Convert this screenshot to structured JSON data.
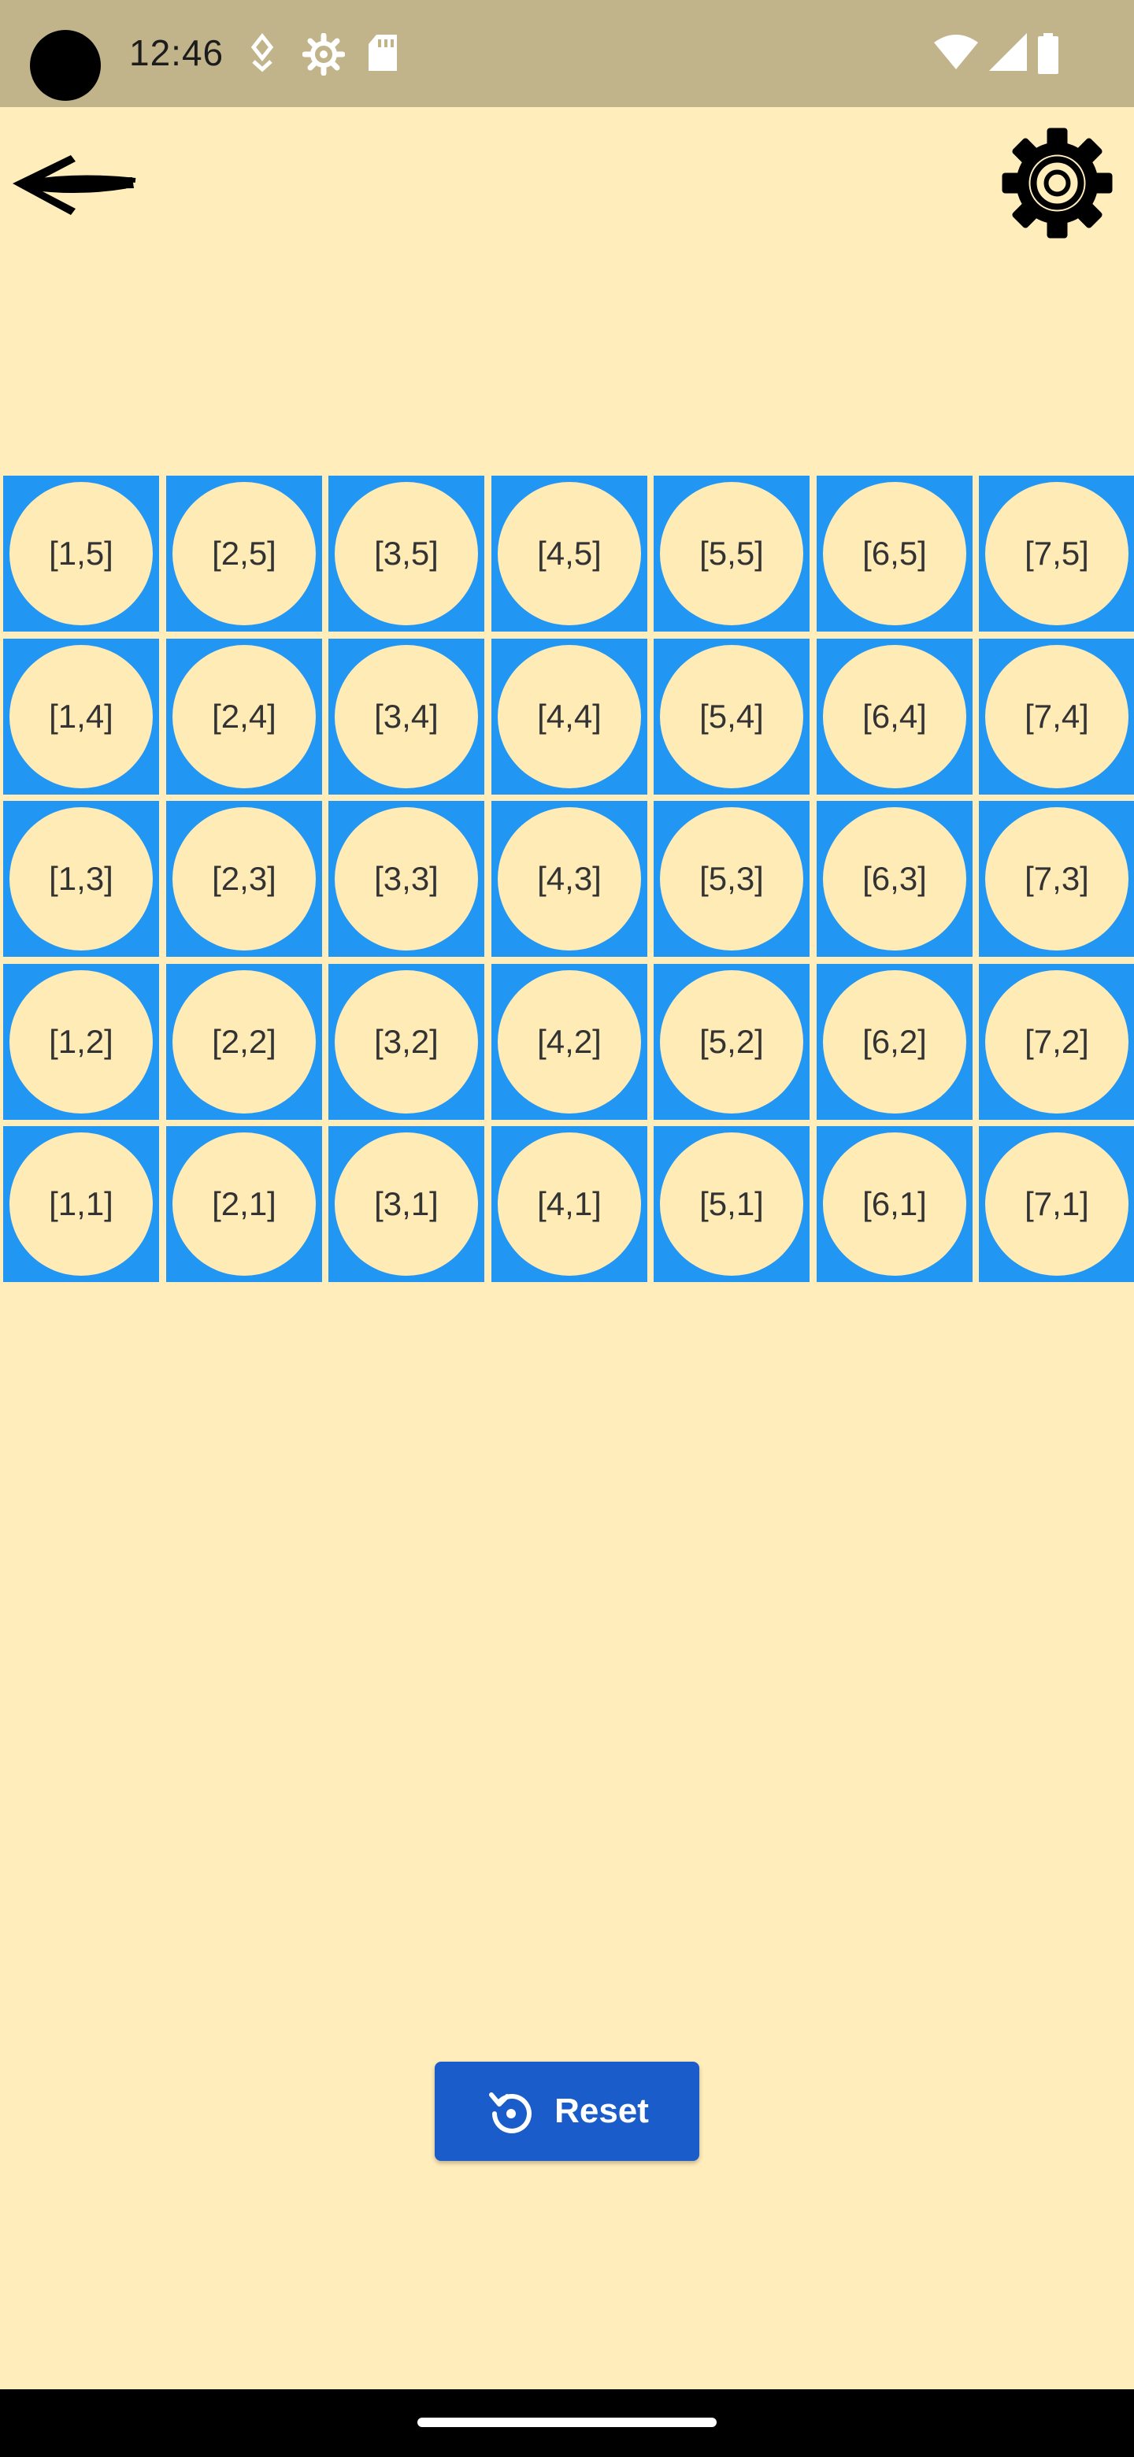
{
  "status_bar": {
    "time": "12:46",
    "icons": [
      "location-icon",
      "settings-icon",
      "sd-card-icon",
      "wifi-icon",
      "signal-icon",
      "battery-icon"
    ]
  },
  "app_bar": {
    "back_icon": "arrow-left-icon",
    "settings_icon": "gear-icon"
  },
  "grid": {
    "rows": [
      [
        "[1,5]",
        "[2,5]",
        "[3,5]",
        "[4,5]",
        "[5,5]",
        "[6,5]",
        "[7,5]"
      ],
      [
        "[1,4]",
        "[2,4]",
        "[3,4]",
        "[4,4]",
        "[5,4]",
        "[6,4]",
        "[7,4]"
      ],
      [
        "[1,3]",
        "[2,3]",
        "[3,3]",
        "[4,3]",
        "[5,3]",
        "[6,3]",
        "[7,3]"
      ],
      [
        "[1,2]",
        "[2,2]",
        "[3,2]",
        "[4,2]",
        "[5,2]",
        "[6,2]",
        "[7,2]"
      ],
      [
        "[1,1]",
        "[2,1]",
        "[3,1]",
        "[4,1]",
        "[5,1]",
        "[6,1]",
        "[7,1]"
      ]
    ]
  },
  "reset": {
    "label": "Reset",
    "icon": "reset-icon"
  },
  "colors": {
    "background": "#FFEDBC",
    "status_bar": "#C1B38A",
    "cell": "#2196F3",
    "circle": "#FFEBB5",
    "button": "#1A5CC9"
  }
}
